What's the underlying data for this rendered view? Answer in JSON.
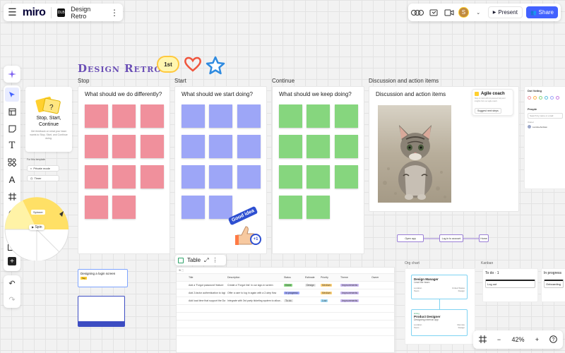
{
  "app": {
    "logo": "miro",
    "board_name": "Design Retro",
    "board_icon_text": "DLB"
  },
  "header_right": {
    "avatar_letter": "S",
    "present_label": "Present",
    "share_label": "Share"
  },
  "board": {
    "title": "Design Retro",
    "sticker_1st": "1st",
    "columns": [
      {
        "label": "Stop",
        "question": "What should we do differently?",
        "color": "#f0909c"
      },
      {
        "label": "Start",
        "question": "What should we start doing?",
        "color": "#9da6f7"
      },
      {
        "label": "Continue",
        "question": "What should we keep doing?",
        "color": "#86d67e"
      },
      {
        "label": "Discussion and action items",
        "question": "Discussion and action items"
      }
    ],
    "good_idea_sticker": "Good idea",
    "plus_one": "+1"
  },
  "instructions": {
    "name_line1": "Stop, Start,",
    "name_line2": "Continue",
    "desc": "Get feedback on what your team wants to Stop, Start, and Continue doing.",
    "template_label": "For this template",
    "private_mode": "Private mode",
    "timer": "Timer"
  },
  "spinner": {
    "label": "Spinner",
    "spin": "Spin"
  },
  "agile_coach": {
    "title": "Agile coach",
    "desc": "Stay on track with AI-powered help and insights from our agile coach.",
    "button": "Suggest next steps"
  },
  "voting": {
    "title": "Dot Voting",
    "people_title": "People",
    "search_placeholder": "Search by name or email",
    "sub": "Owner",
    "person": "Lumina Andrew"
  },
  "flow": {
    "node1": "Open app",
    "node2": "Log in to account",
    "node3": "Home"
  },
  "table_widget": {
    "label": "Table",
    "headers": [
      "Title",
      "Description",
      "Status",
      "Estimate",
      "Priority",
      "Theme",
      "Owner"
    ],
    "rows": [
      [
        "Add a 'Forgot password' feature",
        "Create a 'Forgot link' in our sign-in screen",
        "Done",
        "Design",
        "Medium",
        "Improvements",
        ""
      ],
      [
        "Add 2-factor authentication to login",
        "Offer a user to log in again with a 2-step flow",
        "In progress",
        "",
        "Medium",
        "Improvements",
        ""
      ],
      [
        "Add load time that support the Dark mode",
        "Integrate with 3rd party ticketing system to allow...",
        "To do",
        "",
        "Low",
        "Improvements",
        ""
      ]
    ]
  },
  "screens": {
    "screen1_title": "Designing a login screen",
    "screen1_tag": "Tag"
  },
  "org_chart": {
    "label": "Org chart",
    "card1": {
      "name": "Design Manager",
      "role": "Lead the team",
      "k1": "Location",
      "v1": "United States",
      "k2": "Team",
      "v2": "Design"
    },
    "card2": {
      "badge": "Hiring",
      "name": "Product Designer",
      "role": "Designing internal app",
      "k1": "Location",
      "v1": "Remote",
      "k2": "Team",
      "v2": "Design"
    }
  },
  "kanban": {
    "label": "Kanban",
    "todo_title": "To do",
    "todo_count": "1",
    "todo_card": "Log out",
    "inprogress_title": "In progress",
    "inprogress_card": "Onboarding"
  },
  "zoom": {
    "level": "42%"
  },
  "colors": {
    "accent": "#4262ff",
    "title_purple": "#6b4fb6",
    "stop_pink": "#f0909c",
    "start_blue": "#9da6f7",
    "continue_green": "#86d67e"
  }
}
